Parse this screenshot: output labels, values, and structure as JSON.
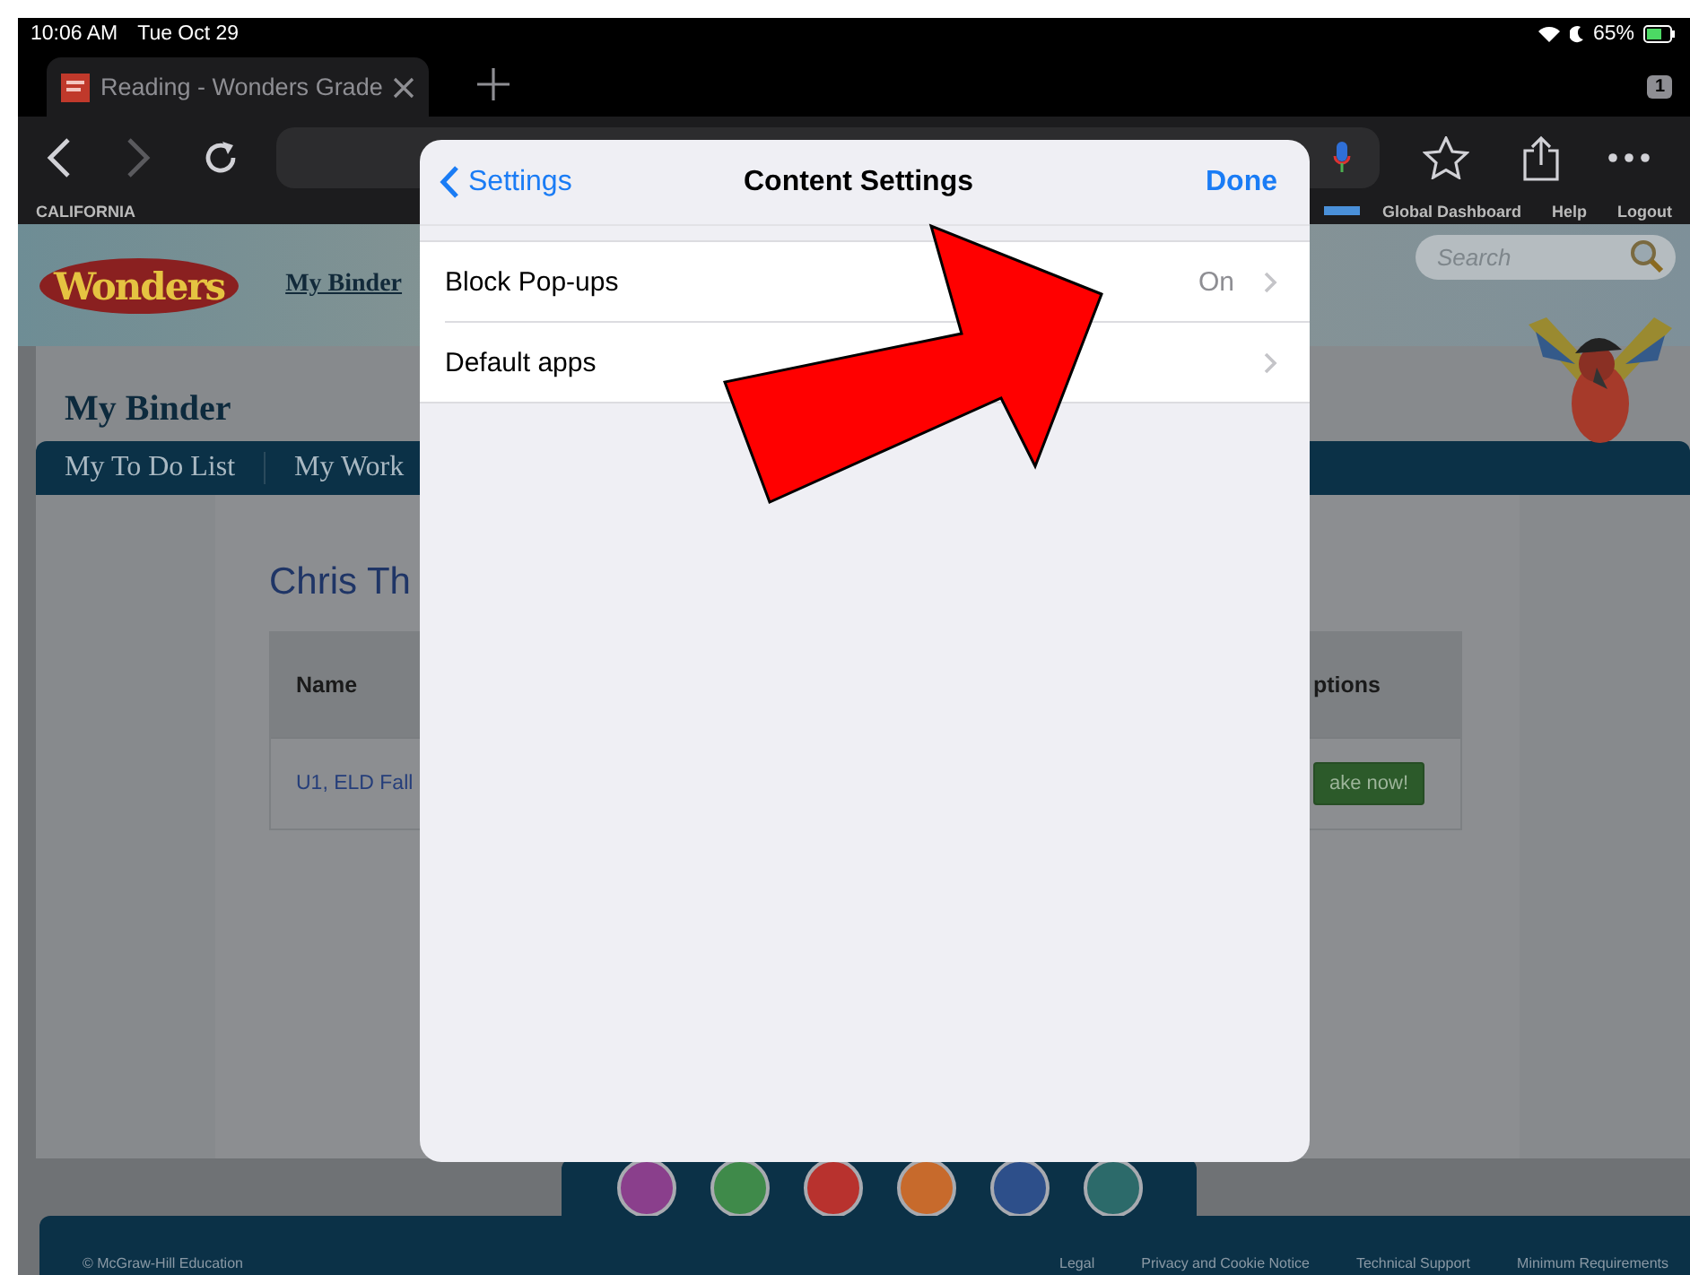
{
  "status_bar": {
    "time": "10:06 AM",
    "date": "Tue Oct 29",
    "battery": "65%"
  },
  "browser": {
    "tab_title": "Reading - Wonders Grade",
    "tab_count": "1",
    "region": "CALIFORNIA",
    "top_links": [
      "Global Dashboard",
      "Help",
      "Logout"
    ]
  },
  "page": {
    "logo": "Wonders",
    "nav_link": "My Binder",
    "search": {
      "placeholder": "Search"
    },
    "heading": "My Binder",
    "tabs": [
      {
        "label": "My To Do List"
      },
      {
        "label": "My Work"
      }
    ],
    "student": "Chris Th",
    "table": {
      "columns": [
        "Name",
        "ptions"
      ],
      "rows": [
        {
          "name": "U1, ELD Fall",
          "action": "ake now!"
        }
      ]
    },
    "apps": [
      {
        "color": "#8a3f8c"
      },
      {
        "color": "#3f8a4a"
      },
      {
        "color": "#b8322e"
      },
      {
        "color": "#c76a2c"
      },
      {
        "color": "#2d4f8a"
      },
      {
        "color": "#2c6a6a"
      }
    ],
    "footer": {
      "copyright": "© McGraw-Hill Education",
      "links": [
        "Legal",
        "Privacy and Cookie Notice",
        "Technical Support",
        "Minimum Requirements"
      ]
    }
  },
  "modal": {
    "back": "Settings",
    "title": "Content Settings",
    "done": "Done",
    "rows": [
      {
        "label": "Block Pop-ups",
        "value": "On"
      },
      {
        "label": "Default apps"
      }
    ]
  }
}
